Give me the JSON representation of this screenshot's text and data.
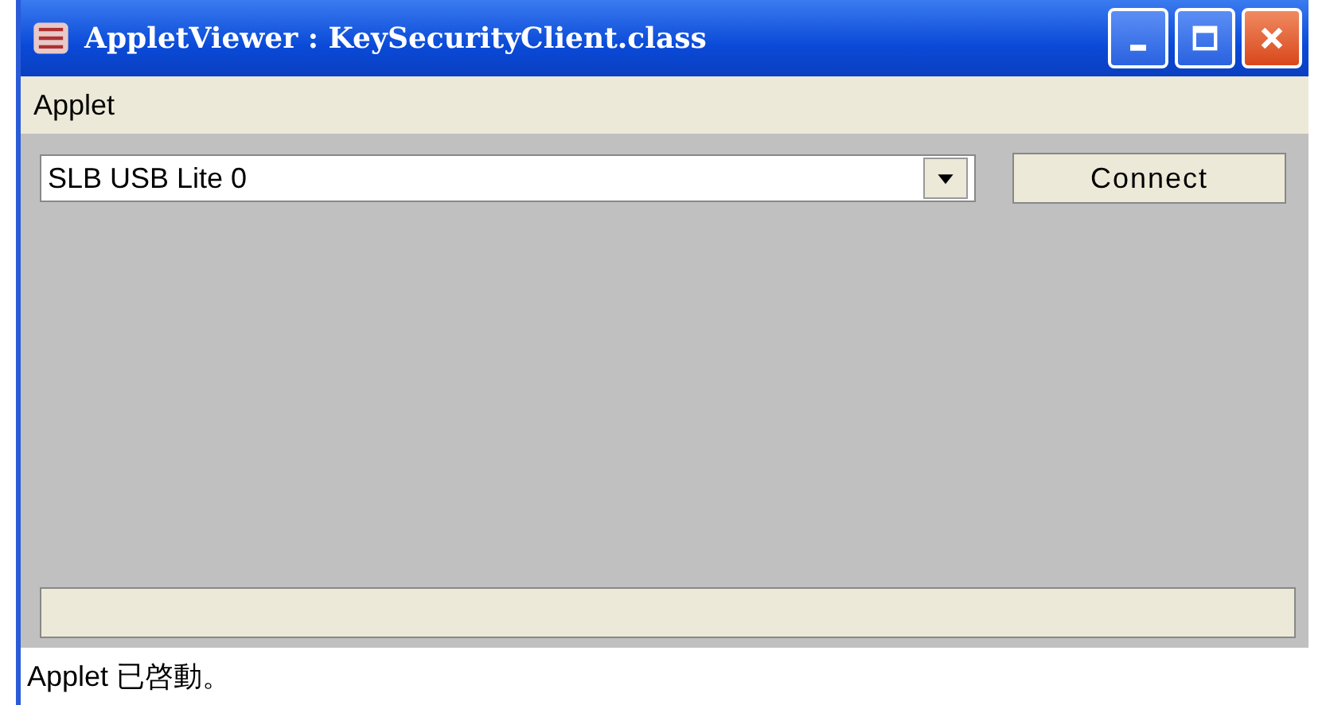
{
  "window": {
    "title": "AppletViewer : KeySecurityClient.class"
  },
  "menu": [
    "Applet"
  ],
  "device_select": {
    "value": "SLB USB Lite 0"
  },
  "buttons": [
    "Connect"
  ],
  "status_bar": "Applet 已啓動。"
}
